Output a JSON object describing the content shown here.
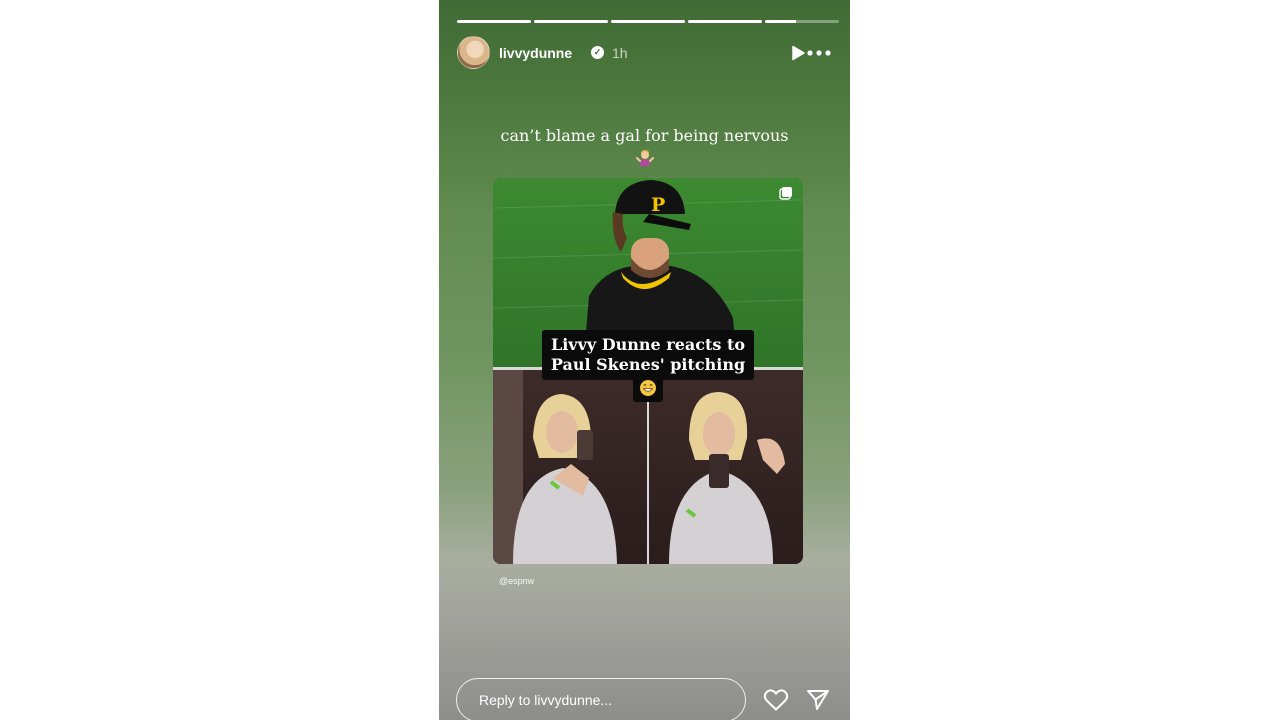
{
  "story": {
    "progress": [
      1,
      1,
      1,
      1,
      0.42
    ],
    "username": "livvydunne",
    "verified": true,
    "time_ago": "1h",
    "caption": "can’t blame a gal for being nervous",
    "caption_emoji": "woman-shrugging-emoji",
    "post": {
      "headline_line1": "Livvy Dunne reacts to",
      "headline_line2": "Paul Skenes' pitching",
      "headline_emoji": "grinning-emoji",
      "credit": "@espnw",
      "cap_letter": "P"
    },
    "reply_placeholder": "Reply to livvydunne..."
  },
  "icons": {
    "play": "play-icon",
    "more": "more-icon",
    "multi": "multiple-posts-icon",
    "like": "heart-icon",
    "send": "send-icon"
  },
  "colors": {
    "story_top": "#3f6a35",
    "story_mid": "#6f9560",
    "story_bottom": "#8d8d8b",
    "badge_bg": "#0b0b0b",
    "cap_letter": "#f2c300"
  }
}
